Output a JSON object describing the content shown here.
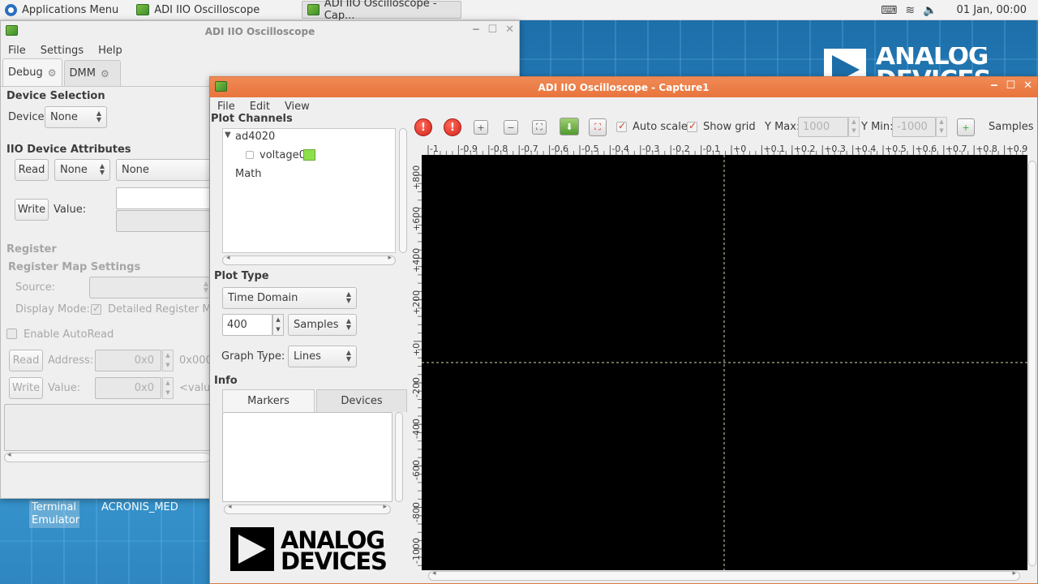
{
  "panel": {
    "apps_menu": "Applications Menu",
    "task1": "ADI IIO Oscilloscope",
    "task2": "ADI IIO Oscilloscope - Cap...",
    "clock": "01 Jan, 00:00"
  },
  "desktop": {
    "logo_line1": "ANALOG",
    "logo_line2": "DEVICES",
    "icon1_line1": "Terminal",
    "icon1_line2": "Emulator",
    "icon2": "ACRONIS_MED"
  },
  "main_window": {
    "title": "ADI IIO Oscilloscope",
    "menu": [
      "File",
      "Settings",
      "Help"
    ],
    "tabs": [
      "Debug",
      "DMM"
    ],
    "device_selection": "Device Selection",
    "device_label": "Device",
    "device_value": "None",
    "attributes_heading": "IIO Device Attributes",
    "read": "Read",
    "attr_combo1": "None",
    "attr_combo2": "None",
    "write": "Write",
    "value_label": "Value:",
    "register_heading": "Register",
    "register_map_heading": "Register Map Settings",
    "source_label": "Source:",
    "display_mode_label": "Display Mode:",
    "detailed_register_map": "Detailed Register Map",
    "enable_autoread": "Enable AutoRead",
    "address_label": "Address:",
    "address_value": "0x0",
    "address_hint": "0x000",
    "reg_value_label": "Value:",
    "reg_value": "0x0",
    "value_hint": "<value"
  },
  "capture_window": {
    "title": "ADI IIO Oscilloscope - Capture1",
    "menu": [
      "File",
      "Edit",
      "View"
    ],
    "plot_channels": "Plot Channels",
    "device_node": "ad4020",
    "channel": "voltage0",
    "channel_color": "#8ee04a",
    "math": "Math",
    "plot_type_heading": "Plot Type",
    "plot_type": "Time Domain",
    "sample_count": "400",
    "sample_unit": "Samples",
    "graph_type_label": "Graph Type:",
    "graph_type": "Lines",
    "info_heading": "Info",
    "info_tabs": [
      "Markers",
      "Devices"
    ],
    "auto_scale": "Auto scale",
    "auto_scale_checked": true,
    "show_grid": "Show grid",
    "show_grid_checked": true,
    "ymax_label": "Y Max:",
    "ymax_value": "1000",
    "ymin_label": "Y Min:",
    "ymin_value": "-1000",
    "samples_label": "Samples",
    "logo_line1": "ANALOG",
    "logo_line2": "DEVICES"
  },
  "plot": {
    "x_ticks": [
      "-1",
      "-0.9",
      "-0.8",
      "-0.7",
      "-0.6",
      "-0.5",
      "-0.4",
      "-0.3",
      "-0.2",
      "-0.1",
      "+0",
      "+0.1",
      "+0.2",
      "+0.3",
      "+0.4",
      "+0.5",
      "+0.6",
      "+0.7",
      "+0.8",
      "+0.9"
    ],
    "y_ticks": [
      "+800",
      "+600",
      "+400",
      "+200",
      "+0",
      "-200",
      "-400",
      "-600",
      "-800",
      "-1000"
    ],
    "background": "#000000",
    "grid_color": "#d8d8b0"
  }
}
